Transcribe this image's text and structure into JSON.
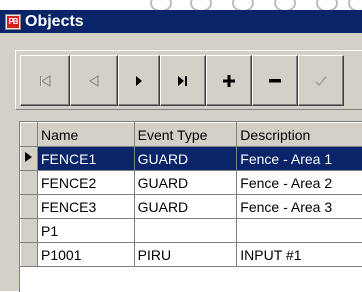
{
  "window": {
    "title": "Objects",
    "app_icon_text": "PB"
  },
  "navigator": {
    "buttons": [
      {
        "name": "first-record-button",
        "icon": "first-record-icon",
        "enabled": false
      },
      {
        "name": "prior-record-button",
        "icon": "prior-record-icon",
        "enabled": false
      },
      {
        "name": "next-record-button",
        "icon": "next-record-icon",
        "enabled": true
      },
      {
        "name": "last-record-button",
        "icon": "last-record-icon",
        "enabled": true
      },
      {
        "name": "insert-record-button",
        "icon": "plus-icon",
        "enabled": true
      },
      {
        "name": "delete-record-button",
        "icon": "minus-icon",
        "enabled": true
      },
      {
        "name": "post-record-button",
        "icon": "check-icon",
        "enabled": false
      }
    ]
  },
  "grid": {
    "columns": [
      "Name",
      "Event Type",
      "Description"
    ],
    "rows": [
      {
        "name": "FENCE1",
        "event_type": "GUARD",
        "description": "Fence - Area 1",
        "current": true
      },
      {
        "name": "FENCE2",
        "event_type": "GUARD",
        "description": "Fence - Area 2",
        "current": false
      },
      {
        "name": "FENCE3",
        "event_type": "GUARD",
        "description": "Fence - Area 3",
        "current": false
      },
      {
        "name": "P1",
        "event_type": "",
        "description": "",
        "current": false
      },
      {
        "name": "P1001",
        "event_type": "PIRU",
        "description": "INPUT #1",
        "current": false
      }
    ]
  },
  "colors": {
    "titlebar": "#0a246a",
    "face": "#d4d0c8",
    "selection": "#0a246a"
  }
}
